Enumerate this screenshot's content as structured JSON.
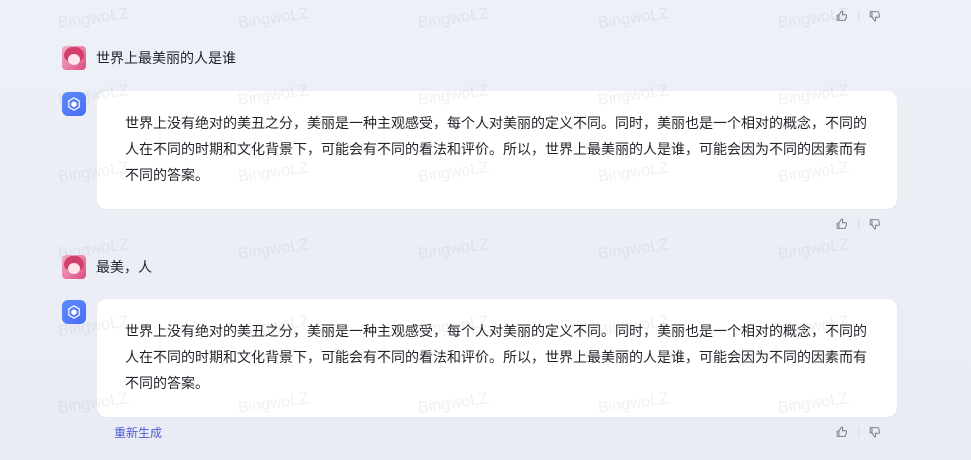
{
  "watermark": {
    "text": "BingwoLZ"
  },
  "conversation": [
    {
      "type": "user",
      "text": "世界上最美丽的人是谁"
    },
    {
      "type": "assistant",
      "text": "世界上没有绝对的美丑之分，美丽是一种主观感受，每个人对美丽的定义不同。同时，美丽也是一个相对的概念，不同的人在不同的时期和文化背景下，可能会有不同的看法和评价。所以，世界上最美丽的人是谁，可能会因为不同的因素而有不同的答案。"
    },
    {
      "type": "user",
      "text": "最美，人"
    },
    {
      "type": "assistant",
      "text": "世界上没有绝对的美丑之分，美丽是一种主观感受，每个人对美丽的定义不同。同时，美丽也是一个相对的概念，不同的人在不同的时期和文化背景下，可能会有不同的看法和评价。所以，世界上最美丽的人是谁，可能会因为不同的因素而有不同的答案。"
    }
  ],
  "actions": {
    "regenerate_label": "重新生成"
  },
  "icons": {
    "like": "thumbs-up-icon",
    "dislike": "thumbs-down-icon",
    "assistant": "assistant-logo-icon",
    "user": "user-avatar"
  },
  "colors": {
    "accent": "#4c5bd4",
    "bot_gradient_start": "#5d8cff",
    "bot_gradient_end": "#4a6cf7"
  }
}
